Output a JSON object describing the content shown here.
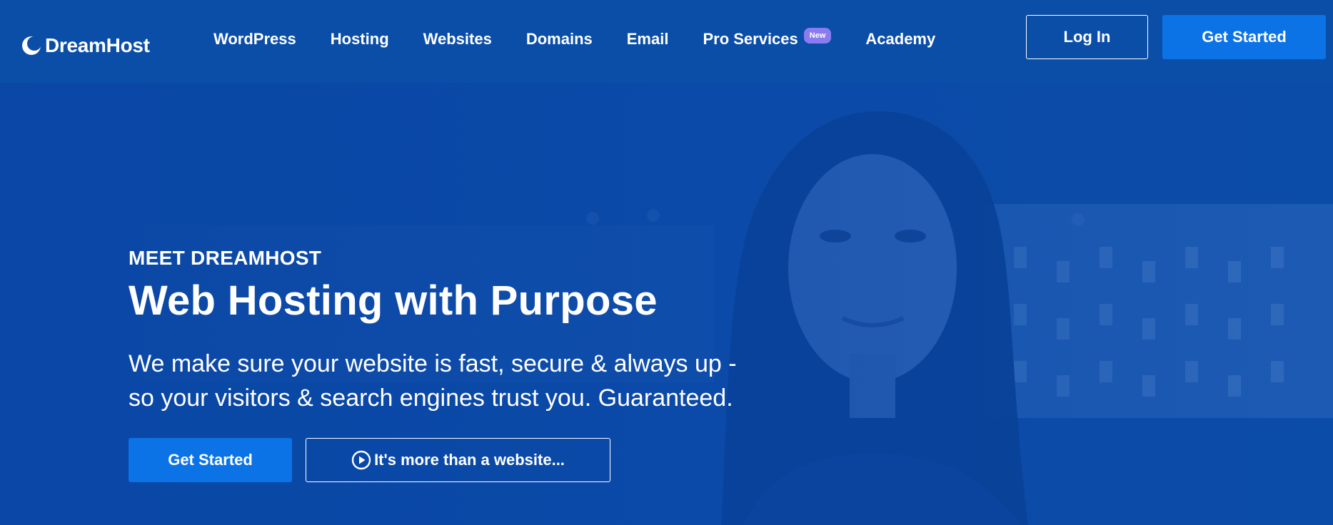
{
  "header": {
    "brand": "DreamHost",
    "logo_icon": "dreamhost-moon-logo-icon",
    "nav": [
      {
        "label": "WordPress"
      },
      {
        "label": "Hosting"
      },
      {
        "label": "Websites"
      },
      {
        "label": "Domains"
      },
      {
        "label": "Email"
      },
      {
        "label": "Pro Services",
        "badge": "New"
      },
      {
        "label": "Academy"
      }
    ],
    "login_label": "Log In",
    "get_started_label": "Get Started"
  },
  "hero": {
    "eyebrow": "MEET DREAMHOST",
    "headline": "Web Hosting with Purpose",
    "subline_1": "We make sure your website is fast, secure & always up -",
    "subline_2": "so your visitors & search engines trust you. Guaranteed.",
    "get_started_label": "Get Started",
    "video_label": "It's more than a website...",
    "video_icon": "play-circle-icon",
    "background_image": "woman-smiling-photo"
  },
  "colors": {
    "header_bg": "#0b4ea8",
    "hero_overlay": "#0a46a5",
    "primary_button": "#0b73e6",
    "badge": "#8a7cf0",
    "text": "#ffffff"
  }
}
